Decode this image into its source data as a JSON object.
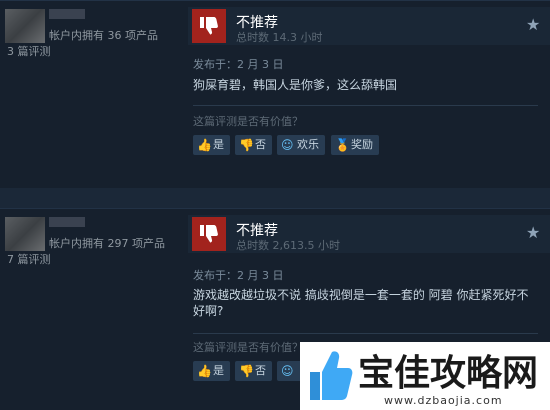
{
  "reviews": [
    {
      "author_products": "帐户内拥有 36 项产品",
      "author_reviews": "3 篇评测",
      "verdict": "不推荐",
      "hours": "总时数 14.3 小时",
      "posted": "发布于：2 月 3 日",
      "content": "狗屎育碧，韩国人是你爹，这么舔韩国",
      "helpful_prompt": "这篇评测是否有价值？",
      "buttons": {
        "yes": "是",
        "no": "否",
        "funny": "欢乐",
        "award": "奖励"
      }
    },
    {
      "author_products": "帐户内拥有 297 项产品",
      "author_reviews": "7 篇评测",
      "verdict": "不推荐",
      "hours": "总时数 2,613.5 小时",
      "posted": "发布于：2 月 3 日",
      "content": "游戏越改越垃圾不说 搞歧视倒是一套一套的 阿碧 你赶紧死好不好啊?",
      "helpful_prompt": "这篇评测是否有价值？",
      "buttons": {
        "yes": "是",
        "no": "否",
        "funny": "",
        "award": ""
      }
    }
  ],
  "watermark": {
    "text": "宝佳攻略网",
    "url": "www.dzbaojia.com"
  },
  "colors": {
    "background": "#1b2838",
    "thumb_down": "#a2231d",
    "accent": "#66c0f4"
  }
}
